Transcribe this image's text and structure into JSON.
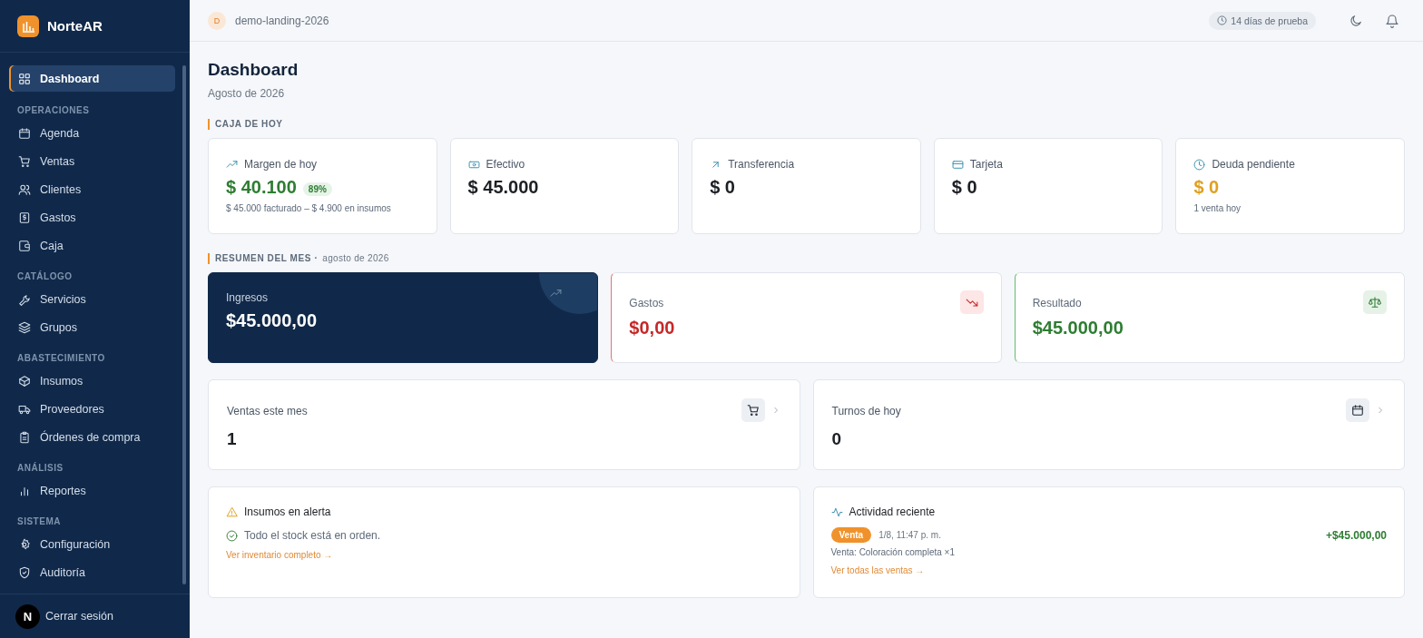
{
  "sidebar": {
    "brand": "NorteAR",
    "sections": [
      {
        "items": [
          {
            "label": "Dashboard",
            "selected": true
          }
        ]
      },
      {
        "heading": "OPERACIONES",
        "items": [
          {
            "label": "Agenda",
            "selected": false
          },
          {
            "label": "Ventas",
            "selected": false
          },
          {
            "label": "Clientes",
            "selected": false
          },
          {
            "label": "Gastos",
            "selected": false
          },
          {
            "label": "Caja",
            "selected": false
          }
        ]
      },
      {
        "heading": "CATÁLOGO",
        "items": [
          {
            "label": "Servicios",
            "selected": false
          },
          {
            "label": "Grupos",
            "selected": false
          }
        ]
      },
      {
        "heading": "ABASTECIMIENTO",
        "items": [
          {
            "label": "Insumos",
            "selected": false
          },
          {
            "label": "Proveedores",
            "selected": false
          },
          {
            "label": "Órdenes de compra",
            "selected": false
          }
        ]
      },
      {
        "heading": "ANÁLISIS",
        "items": [
          {
            "label": "Reportes",
            "selected": false
          }
        ]
      },
      {
        "heading": "SISTEMA",
        "items": [
          {
            "label": "Configuración",
            "selected": false
          },
          {
            "label": "Auditoría",
            "selected": false
          }
        ]
      }
    ],
    "logout": "Cerrar sesión",
    "dev_badge": "N"
  },
  "topbar": {
    "avatar": "D",
    "workspace": "demo-landing-2026",
    "trial": "14 días de prueba"
  },
  "page": {
    "title": "Dashboard",
    "subtitle": "Agosto de 2026"
  },
  "today": {
    "heading": "CAJA DE HOY",
    "cards": [
      {
        "label": "Margen de hoy",
        "value": "$ 40.100",
        "kind": "positive",
        "badge": "89%",
        "note": "$ 45.000 facturado – $ 4.900 en insumos"
      },
      {
        "label": "Efectivo",
        "value": "$ 45.000",
        "kind": "neutral"
      },
      {
        "label": "Transferencia",
        "value": "$ 0",
        "kind": "neutral"
      },
      {
        "label": "Tarjeta",
        "value": "$ 0",
        "kind": "neutral"
      },
      {
        "label": "Deuda pendiente",
        "value": "$ 0",
        "kind": "warning",
        "note": "1 venta hoy"
      }
    ]
  },
  "month": {
    "heading": "RESUMEN DEL MES ·",
    "period": "agosto de 2026",
    "cards": [
      {
        "label": "Ingresos",
        "value": "$45.000,00",
        "kind": "primary"
      },
      {
        "label": "Gastos",
        "value": "$0,00",
        "kind": "negative"
      },
      {
        "label": "Resultado",
        "value": "$45.000,00",
        "kind": "positive"
      }
    ]
  },
  "stats": [
    {
      "label": "Ventas este mes",
      "value": "1"
    },
    {
      "label": "Turnos de hoy",
      "value": "0"
    }
  ],
  "alerts": {
    "title": "Insumos en alerta",
    "status": "Todo el stock está en orden.",
    "link": "Ver inventario completo →"
  },
  "activity": {
    "title": "Actividad reciente",
    "entries": [
      {
        "tag": "Venta",
        "time": "1/8, 11:47 p. m.",
        "description": "Venta: Coloración completa ×1",
        "amount": "+$45.000,00"
      }
    ],
    "link": "Ver todas las ventas →"
  }
}
